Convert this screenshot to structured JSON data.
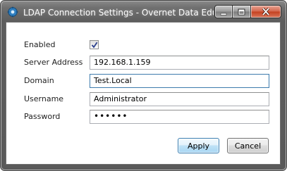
{
  "window": {
    "title": "LDAP Connection Settings - Overnet Data EduLi...",
    "icon": "gear-icon"
  },
  "caption_buttons": {
    "minimize_icon": "minimize-icon",
    "maximize_icon": "maximize-icon",
    "close_icon": "close-icon"
  },
  "form": {
    "enabled": {
      "label": "Enabled",
      "checked": true
    },
    "server_address": {
      "label": "Server Address",
      "value": "192.168.1.159"
    },
    "domain": {
      "label": "Domain",
      "value": "Test.Local"
    },
    "username": {
      "label": "Username",
      "value": "Administrator"
    },
    "password": {
      "label": "Password",
      "value": "••••••"
    }
  },
  "buttons": {
    "apply_label": "Apply",
    "cancel_label": "Cancel"
  },
  "colors": {
    "focus_border": "#3d7bad",
    "close_button": "#c4401f",
    "default_button_border": "#3c7fb1"
  }
}
